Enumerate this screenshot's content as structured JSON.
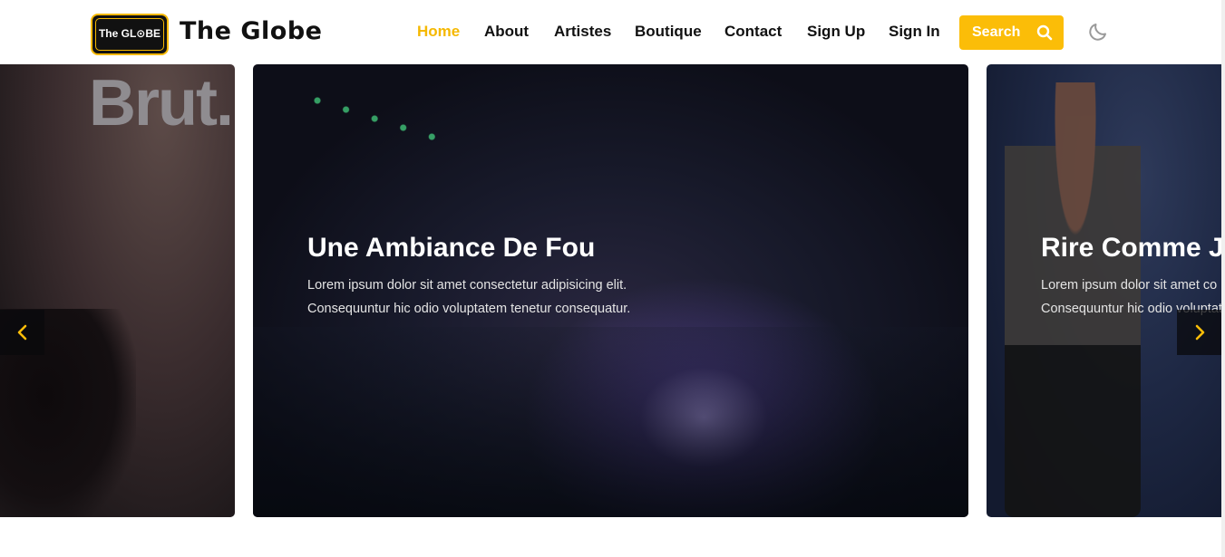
{
  "header": {
    "logo_text": "The GL⊙BE",
    "brand": "The Globe",
    "nav": [
      {
        "label": "Home",
        "active": true
      },
      {
        "label": "About",
        "active": false
      },
      {
        "label": "Artistes",
        "active": false
      },
      {
        "label": "Boutique",
        "active": false
      },
      {
        "label": "Contact",
        "active": false
      },
      {
        "label": "Sign Up",
        "active": false
      },
      {
        "label": "Sign In",
        "active": false
      }
    ],
    "search_label": "Search",
    "search_icon": "search-icon",
    "theme_icon": "moon-icon"
  },
  "carousel": {
    "prev_icon": "chevron-left-icon",
    "next_icon": "chevron-right-icon",
    "slides": [
      {
        "overlay_text": "Brut."
      },
      {
        "title": "Une Ambiance De Fou",
        "text_line1": "Lorem ipsum dolor sit amet consectetur adipisicing elit.",
        "text_line2": "Consequuntur hic odio voluptatem tenetur consequatur."
      },
      {
        "title": "Rire Comme J",
        "text_line1": "Lorem ipsum dolor sit amet co",
        "text_line2": "Consequuntur hic odio voluptat"
      }
    ]
  },
  "colors": {
    "accent": "#fbbd08",
    "nav_active": "#f5b800",
    "text": "#111111"
  }
}
